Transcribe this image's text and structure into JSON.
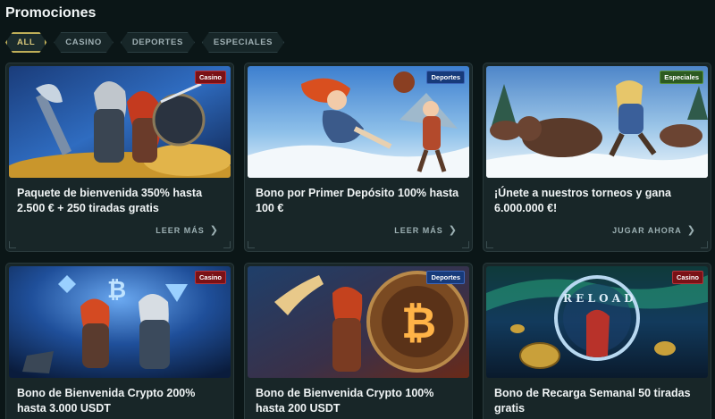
{
  "page": {
    "title": "Promociones"
  },
  "filters": [
    {
      "label": "ALL",
      "active": true
    },
    {
      "label": "CASINO",
      "active": false
    },
    {
      "label": "DEPORTES",
      "active": false
    },
    {
      "label": "ESPECIALES",
      "active": false
    }
  ],
  "cards": [
    {
      "badge": "Casino",
      "badge_type": "casino",
      "title": "Paquete de bienvenida 350% hasta 2.500 € + 250 tiradas gratis",
      "cta": "LEER MÁS",
      "image": "viking-couple-treasure-illustration"
    },
    {
      "badge": "Deportes",
      "badge_type": "deportes",
      "title": "Bono por Primer Depósito 100% hasta 100 €",
      "cta": "LEER MÁS",
      "image": "viking-woman-snowball-illustration"
    },
    {
      "badge": "Especiales",
      "badge_type": "especiales",
      "title": "¡Únete a nuestros torneos y gana 6.000.000 €!",
      "cta": "JUGAR AHORA",
      "image": "viking-boar-race-illustration"
    },
    {
      "badge": "Casino",
      "badge_type": "casino",
      "title": "Bono de Bienvenida Crypto 200% hasta 3.000 USDT",
      "cta": "",
      "image": "viking-crypto-coins-illustration"
    },
    {
      "badge": "Deportes",
      "badge_type": "deportes",
      "title": "Bono de Bienvenida Crypto 100% hasta 200 USDT",
      "cta": "",
      "image": "viking-horn-bitcoin-shield-illustration"
    },
    {
      "badge": "Casino",
      "badge_type": "casino",
      "title": "Bono de Recarga Semanal 50 tiradas gratis",
      "cta": "",
      "image": "reload-portal-viking-illustration"
    }
  ],
  "colors": {
    "background": "#0b1617",
    "card": "#182628",
    "active_chip_border": "#bfae58",
    "casino_badge": "#7a1116",
    "deportes_badge": "#173a7a",
    "especiales_badge": "#2c5a21"
  }
}
